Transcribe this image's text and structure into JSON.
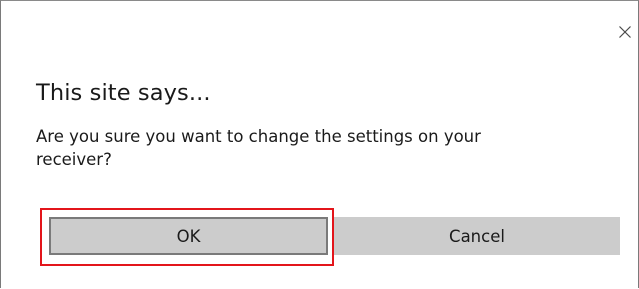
{
  "dialog": {
    "title": "This site says...",
    "message": "Are you sure you want to change the settings on your receiver?",
    "close_icon": "close-icon",
    "buttons": {
      "ok_label": "OK",
      "cancel_label": "Cancel"
    },
    "colors": {
      "button_bg": "#cccccc",
      "highlight_outline": "#e3151b",
      "text": "#1a1a1a"
    }
  }
}
